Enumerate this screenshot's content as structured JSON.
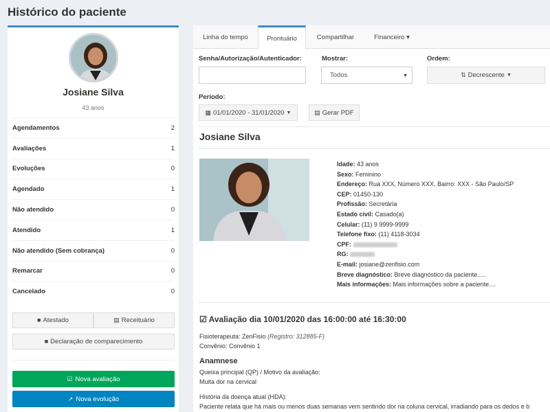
{
  "page_title": "Histórico do paciente",
  "patient": {
    "name": "Josiane Silva",
    "age": "43 anos"
  },
  "stats": [
    {
      "label": "Agendamentos",
      "count": "2"
    },
    {
      "label": "Avaliações",
      "count": "1"
    },
    {
      "label": "Evoluções",
      "count": "0"
    },
    {
      "label": "Agendado",
      "count": "1"
    },
    {
      "label": "Não atendido",
      "count": "0"
    },
    {
      "label": "Atendido",
      "count": "1"
    },
    {
      "label": "Não atendido (Sem cobrança)",
      "count": "0"
    },
    {
      "label": "Remarcar",
      "count": "0"
    },
    {
      "label": "Cancelado",
      "count": "0"
    }
  ],
  "buttons": {
    "atestado": "Atestado",
    "receituario": "Receituário",
    "declaracao": "Declaração de comparecimento",
    "nova_avaliacao": "Nova avaliação",
    "nova_evolucao": "Nova evolução",
    "gerar_pdf": "Gerar PDF"
  },
  "tabs": [
    {
      "label": "Linha do tempo"
    },
    {
      "label": "Prontuário"
    },
    {
      "label": "Compartilhar"
    },
    {
      "label": "Financeiro ▾"
    }
  ],
  "filters": {
    "senha_label": "Senha/Autorização/Autenticador:",
    "senha_value": "",
    "mostrar_label": "Mostrar:",
    "mostrar_value": "Todos",
    "ordem_label": "Ordem:",
    "ordem_value": "Decrescente",
    "periodo_label": "Período:",
    "periodo_value": "01/01/2020 - 31/01/2020"
  },
  "details": {
    "idade_label": "Idade:",
    "idade": "43 anos",
    "sexo_label": "Sexo:",
    "sexo": "Feminino",
    "endereco_label": "Endereço:",
    "endereco": "Rua XXX, Número XXX, Bairro: XXX - São Paulo/SP",
    "cep_label": "CEP:",
    "cep": "01450-130",
    "profissao_label": "Profissão:",
    "profissao": "Secretária",
    "estado_civil_label": "Estado civil:",
    "estado_civil": "Casado(a)",
    "celular_label": "Celular:",
    "celular": "(11) 9 9999-9999",
    "telefone_label": "Telefone fixo:",
    "telefone": "(11) 4118-3034",
    "cpf_label": "CPF:",
    "rg_label": "RG:",
    "email_label": "E-mail:",
    "email": "josiane@zenfisio.com",
    "diagnostico_label": "Breve diagnóstico:",
    "diagnostico": "Breve diagnóstico da paciente.....",
    "mais_label": "Mais informações:",
    "mais": "Mais informações sobre a paciente...."
  },
  "avaliacao": {
    "title": "Avaliação dia 10/01/2020 das 16:00:00 até 16:30:00",
    "fisio_label": "Fisioterapeuta: ZenFisio",
    "registro": "(Registro: 312885-F)",
    "convenio": "Convênio: Convênio 1",
    "anamnese": "Anamnese",
    "queixa_label": "Queixa principal (QP) / Motivo da avaliação:",
    "queixa": "Muita dor na cervical",
    "hda_label": "História da doença atual (HDA):",
    "hda": "Paciente relata que há mais ou menos duas semanas vem sentindo dor na coluna cervical, irradiando para os dedos e b"
  },
  "colors": {
    "accent": "#3c8dbc",
    "green": "#00a65a",
    "blue": "#0085c0",
    "background": "#ecf0f5"
  },
  "icons": [
    "file-icon",
    "file-text-icon",
    "check-square-icon",
    "line-chart-icon",
    "calendar-icon",
    "sort-icon",
    "pdf-icon",
    "caret-down-icon"
  ]
}
